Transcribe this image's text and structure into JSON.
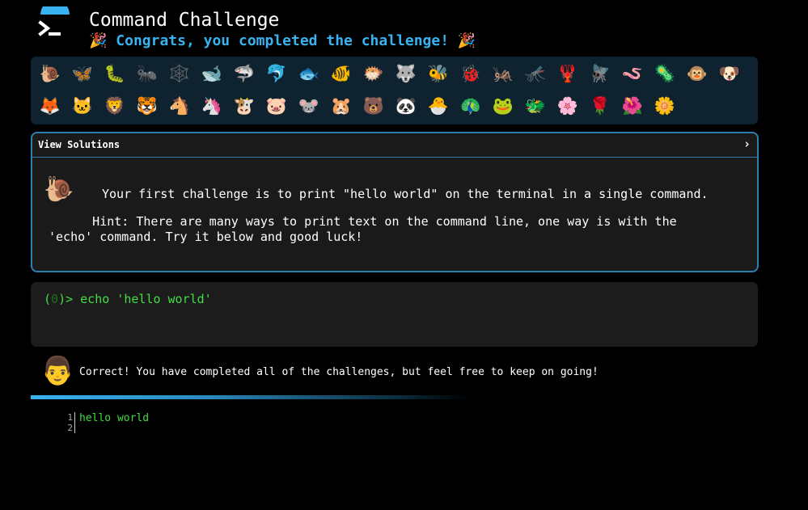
{
  "header": {
    "logo_icon": "terminal-prompt-icon",
    "title": "Command Challenge",
    "congrats_emoji": "🎉",
    "congrats_text": "Congrats, you completed the challenge!"
  },
  "emoji_rows": [
    [
      "🐌",
      "🦋",
      "🐛",
      "🐜",
      "🕸️",
      "🐋",
      "🦈",
      "🐬",
      "🐟",
      "🐠",
      "🐡",
      "🐺",
      "🐝",
      "🐞",
      "🦗",
      "🦟",
      "🦞",
      "🪰",
      "🪱",
      "🦠",
      "🐵",
      "🐶"
    ],
    [
      "🦊",
      "🐱",
      "🦁",
      "🐯",
      "🐴",
      "🦄",
      "🐮",
      "🐷",
      "🐭",
      "🐹",
      "🐻",
      "🐼",
      "🐣",
      "🦚",
      "🐸",
      "🐲",
      "🌸",
      "🌹",
      "🌺",
      "🌼"
    ]
  ],
  "solutions": {
    "title": "View Solutions",
    "chevron": "›",
    "challenge_icon": "🐌",
    "challenge_text": "Your first challenge is to print \"hello world\" on the terminal in a single command.",
    "hint_text": "      Hint: There are many ways to print text on the command line, one way is with the\n'echo' command. Try it below and good luck!"
  },
  "terminal": {
    "prompt_open": "(",
    "prompt_num": "0",
    "prompt_close": ")>",
    "command": "echo 'hello world'"
  },
  "result": {
    "avatar": "👨",
    "text": "Correct! You have completed all of the challenges, but feel free to keep on going!"
  },
  "output": {
    "line_numbers": [
      "1",
      "2"
    ],
    "text": "hello world"
  },
  "colors": {
    "accent": "#39b3f0",
    "border": "#2c7fb0",
    "terminal_green": "#44dd44",
    "panel_bg": "#0e2230"
  }
}
